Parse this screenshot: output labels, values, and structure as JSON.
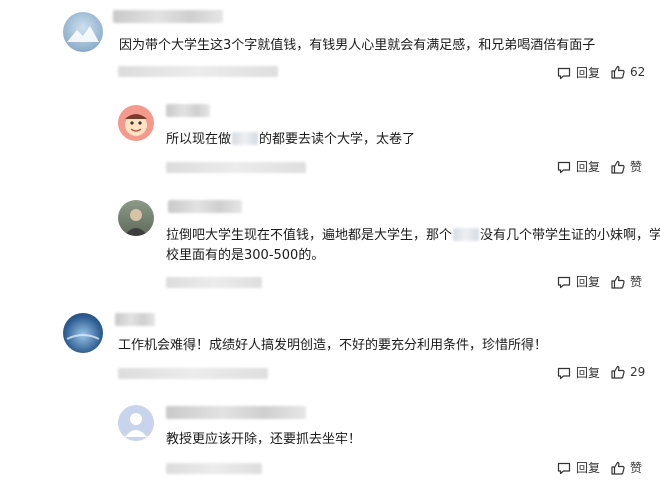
{
  "comments": [
    {
      "text": "因为带个大学生这3个字就值钱，有钱男人心里就会有满足感，和兄弟喝酒倍有面子",
      "reply_label": "回复",
      "like_value": "62"
    },
    {
      "text_before": "所以现在做",
      "text_after": "的都要去读个大学，太卷了",
      "reply_label": "回复",
      "like_value": "赞"
    },
    {
      "line1_before": "拉倒吧大学生现在不值钱，遍地都是大学生，那个",
      "line1_after": "没有几个带学生证的小妹啊，学",
      "line2": "校里面有的是300-500的。",
      "reply_label": "回复",
      "like_value": "赞"
    },
    {
      "text": "工作机会难得！成绩好人搞发明创造，不好的要充分利用条件，珍惜所得！",
      "reply_label": "回复",
      "like_value": "29"
    },
    {
      "text": "教授更应该开除，还要抓去坐牢！",
      "reply_label": "回复",
      "like_value": "赞"
    }
  ],
  "icons": {
    "reply": "comment-bubble-icon",
    "like": "thumbs-up-icon"
  },
  "colors": {
    "text": "#1a1a1a",
    "action": "#333333",
    "background": "#ffffff"
  }
}
